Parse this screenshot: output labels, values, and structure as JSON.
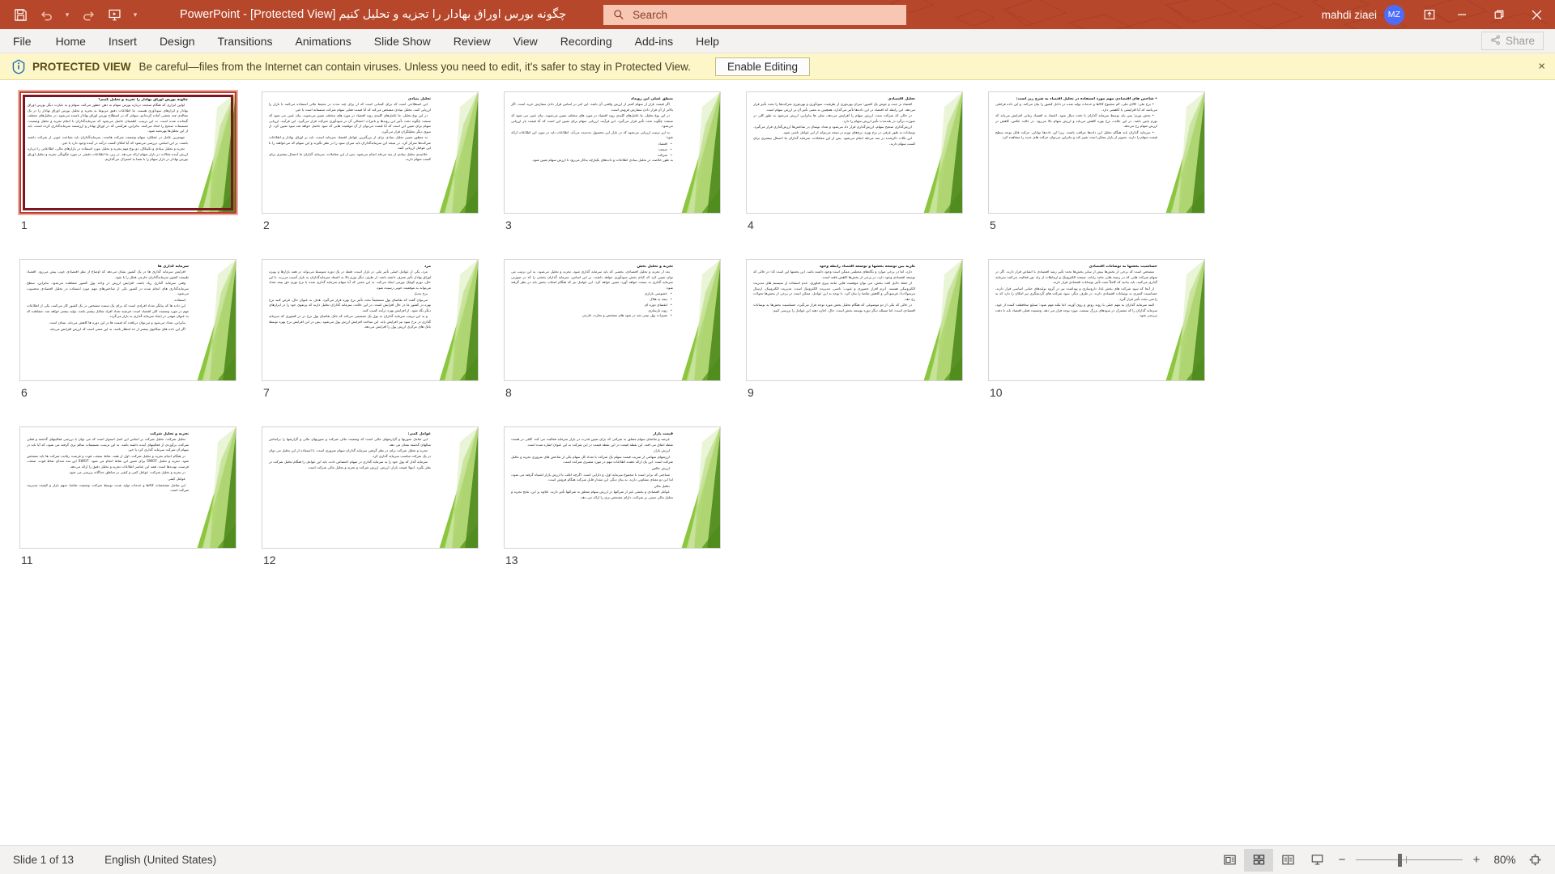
{
  "titlebar": {
    "document_title": "چگونه بورس اوراق بهادار را تجزیه و تحلیل کنیم [Protected View]  -  PowerPoint",
    "quick_access": [
      {
        "name": "save-icon",
        "label": "Save"
      },
      {
        "name": "undo-icon",
        "label": "Undo"
      },
      {
        "name": "undo-dropdown-icon",
        "label": "Undo options"
      },
      {
        "name": "redo-icon",
        "label": "Redo"
      },
      {
        "name": "start-presentation-icon",
        "label": "Start From Beginning"
      },
      {
        "name": "customize-quick-access-toolbar-icon",
        "label": "Customize Quick Access Toolbar"
      }
    ],
    "search": {
      "placeholder": "Search",
      "value": ""
    },
    "account_name": "mahdi ziaei",
    "account_initials": "MZ",
    "ribbon_display_options_label": "Ribbon Display Options",
    "minimize_label": "Minimize",
    "restore_label": "Restore Down",
    "close_label": "Close",
    "bg_color": "#b7472a",
    "search_bg_color": "#f7c7b4",
    "avatar_color": "#4d6cfa"
  },
  "ribbon": {
    "tabs": [
      {
        "label": "File"
      },
      {
        "label": "Home"
      },
      {
        "label": "Insert"
      },
      {
        "label": "Design"
      },
      {
        "label": "Transitions"
      },
      {
        "label": "Animations"
      },
      {
        "label": "Slide Show"
      },
      {
        "label": "Review"
      },
      {
        "label": "View"
      },
      {
        "label": "Recording"
      },
      {
        "label": "Add-ins"
      },
      {
        "label": "Help"
      }
    ],
    "share_label": "Share"
  },
  "protected_view": {
    "title": "PROTECTED VIEW",
    "message": "Be careful—files from the Internet can contain viruses. Unless you need to edit, it's safer to stay in Protected View.",
    "enable_label": "Enable Editing",
    "close_label": "×",
    "bg_color": "#fdf6c8"
  },
  "slides": [
    {
      "number": "1",
      "selected": true,
      "framed": true,
      "title": "چگونه بورس اوراق بهادار را تجزیه و تحلیل کنیم؟",
      "paragraphs": [
        "اولین ابزاری که هنگام صحبت درباره بورس سهام به ذهن خطور می‌کند، سهام و به عبارت دیگر بورس اوراق بهادار و ابزارهای سودآوری هستند. ما اطلاعات دقیق مربوط به تجزیه و تحلیل بورس اوراق بهادار را در یک مقاله‌ی چند بخشی آماده کرده‌ایم، سهام، که در اصطلاح بورس اوراق بهادار نامیده می‌شود، در تحلیل‌های مختلف گنجانده شده است. به این ترتیب، اطمینان حاصل می‌شود که سرمایه‌گذاران با انجام تجزیه و تحلیل وضعیت، تصمیمات صحیح را اتخاذ می‌کنند. بنابراین، هرکسی که در اوراق بهادار و ارزشمند سرمایه‌گذاری کرده است، باید از این تحلیل‌ها بهره‌مند شود.",
        "مهمترین عامل در عملکرد سهام وضعیت شرکت هاست. سرمایه‌گذاران باید شناخت خوبی از شرکت داشته باشند. بر این اساس، بررسی می‌شود که آیا امکان کسب درآمد در آینده وجود دارد یا خیر.",
        "تجزیه و تحلیل بنیادی و تکنیکال، دو نوع مهم تجزیه و تحلیل مورد استفاده در بازارهای مالی، اطلاعاتی را درباره ارزش آینده مقالات در بازار سهام ارائه می‌دهد. در زیر، ما اطلاعات دقیقی در مورد چگونگی تجزیه و تحلیل اوراق بورس بهادار در بازار سهام را با شما به اشتراک می‌گذاریم."
      ],
      "bullets": []
    },
    {
      "number": "2",
      "selected": false,
      "framed": false,
      "title": "تحلیل بنیادی",
      "paragraphs": [
        "این اصطلاحی است که برای کسانی است که از برای چند مدت در محیط مالی استفاده می‌کنند تا بازار را ارزیابی کنند. تحلیل بنیادی مشخص می‌کند که آیا قیمت فعلی سهام شرکت منصفانه است یا خیر.",
        "در این نوع تحلیل، ما عامل‌های کلیدی روند اقتصاد در مورد های مختلف تعیین می‌شوند. بیان عینی می شود که صنعت چگونه تحت تأثیر این روندها و تاثیرات احتمالی آن در سودآوری شرکت قرار می‌گیرد. این فرآیند، ارزیابی سهام برای تعیین این است که آیا قیمت می‌توان از آن موقعیت هایی که سود حاصل خواهد شد سود تعیین کرد. از سوی دیگر تحلیلگران قرار می‌گیرد.",
        "به منظور تعیین تحلیل بنیادی برای از بزرگترین عوامل اقتصاد سرمایه است، باید بر اوراق بهادار و اطلاعات شرکت‌ها تمرکز کرد. در نتیجه این سرمایه‌گذاران باید میزان سود را در نظر بگیرند و این سهام که می‌خواهند را با این عوامل ارزیابی کنند.",
        "خلاصه‌ی تحلیل بنیادی از سه مرحله انجام می‌شود. پس از این معاملات، سرمایه گذاران ما احتمال بیشتری برای کسب سهام دارند."
      ],
      "bullets": []
    },
    {
      "number": "3",
      "selected": false,
      "framed": false,
      "title": "منطق عملی این رویداد",
      "paragraphs": [
        "اگر قیمت بازار از سهام کمتر از ارزش واقعی آن باشد، این امر در اساس قرار دادن سفارش خرید است. اگر بالاتر از آن قرار دادن سفارش فروش است.",
        "در این نوع تحلیل، ما عامل‌های کلیدی روند اقتصاد در مورد های مختلف تعیین می‌شوند. بیان عینی می شود که صنعت چگونه تحت تأثیر قرار می‌گیرد. این فرآیند، ارزیابی سهام برای تعیین این است که آیا قیمت باز ارزیابی می‌شود.",
        "به این ترتیب ارزیابی می‌شود که در بازار این محصول به‌دست می‌آید. اطلاعات باید در مورد این اطلاعات ارائه شود:"
      ],
      "bullets": [
        "اقتصاد",
        "صنعت",
        "شرکت"
      ],
      "tail": "به طور خلاصه، در تحلیل بنیادی اطلاعات و داده‌های یکپارچه به‌کار می‌رود تا ارزش سهام تعیین شود."
    },
    {
      "number": "4",
      "selected": false,
      "framed": false,
      "title": "تحلیل اقتصادی",
      "paragraphs": [
        "اقتصاد بر جنب و جوش یک کشور؛ میزان بهره‌وری از ظرفیت، سودآوری و بهره‌وری شرکت‌ها را تحت تأثیر قرار می‌دهد. این رابطه که اقتصاد در این داده‌ها تأثیر می‌گذارد، همچنین به معنی تأثیر آن بر ارزش سهام است.",
        "در حالی که شرکت منت، ارزش سهام را افزایش می‌دهد، مثلی ها بنابراین، ارزش می‌شود به طور کلی در صورت برگرد در بلندمدت تأثیر ارزش سهام را دارد.",
        "ارزش‌گذاری صحیح سهام، ارزش‌گذاری قرار داد می‌شود و تعداد نوسان در شاخص‌ها ارزش‌گذاری قرار می‌گیرد. نوسانات به طور عرفی در نرخ بهره، نرخ‌های تورم در نتیجه می‌تواند از این عوامل ناشی شود.",
        "این نکات ذکرشده در سه مرحله انجام می‌شود. پس از این معاملات، سرمایه گذاران ما احتمال بیشتری برای کسب سهام دارند."
      ],
      "bullets": []
    },
    {
      "number": "5",
      "selected": false,
      "framed": false,
      "title": "• شاخص های اقتصادی مهم مورد استفاده در تحلیل اقتصاد به شرح زیر است:",
      "paragraphs": [
        "• نرخ ملی: کالای ملی، کم مجموع کالاها و خدمات تولید شده در داخل کشور را بیان می‌کند. و این داده فراملی می‌باشد که آیا افزایشی یا کاهشی دارد.",
        "• بخش تورم: پس باید توسط سرمایه گذاران با دقت دنبال شود. اعتماد به اقتصاد زمانی افزایش می‌یابد که تورم پایین باشد. در این حالت، نرخ بهره کاهش می‌یابد و ارزش سهام بالا می‌رود. در حالت عکس، کاهش در ارزش سهام رخ می‌دهد.",
        "• سرمایه گذاران باید هنگام تحلیل این داده‌ها مراقب باشند. زیرا این داده‌ها توانایی حرکت قابل توجه سطح قیمت سهام را دارند. تصویر از بازار ممکن است تغییر کند و بنابراین می‌توان حرکت های جدید را مشاهده کرد."
      ],
      "bullets": []
    },
    {
      "number": "6",
      "selected": false,
      "framed": false,
      "title": "سرمایه گذاری ها",
      "paragraphs": [
        "افزایش سرمایه گذاری ها در یک کشور نشان می‌دهد که اوضاع از نظر اقتصادی خوب پیش می‌رود. اقتصاد طبیعت کشور سرمایه‌گذاران خارجی فعال را با نفوذ.",
        "وقتی سرمایه گذاری زیاد باشد، افزایش ارزش در واحد پول کشور مشاهده می‌شود. بنابراین، سطح سرمایه‌گذاری های انجام شده در کشور یکی از شاخص‌های مهم مورد استفاده در تحلیل اقتصادی محسوب می‌شود.",
        "استفاده",
        "این داده ها که بیانگر تعداد افرادی است که برای یک سمت مشخص در یک کشور کار می‌کنند، یکی از اطلاعات مهم در مورد وضعیت کلی اقتصاد است. فرضیه تعداد افراد شاغل بیشتر باشد، تولید بیشتر خواهد شد. مشاهده که به عنوان مهمی در ایجاد سرمایه گذاری به بازار می‌گردد.",
        "بنابراین، تعداد می‌شود و می‌توان دریافت که قیمت ها در این دوره ها کاهش می‌یابد. نشان است.",
        "اگر این داده های میکانوی بیشتر از حد انتظار باشد، به این معنی است که ارزش افزایش می‌یابد."
      ],
      "bullets": []
    },
    {
      "number": "7",
      "selected": false,
      "framed": false,
      "title": "مزد",
      "paragraphs": [
        "مزد، یکی از عوامل اصلی تأثیر ملی در بازار است، فقط در یک دوره متوسط می‌تواند در همه بازارها و بویژه اوراق بهادار تأثیر معرف داشته باشد. از طرف دیگر تورم بالا به اعتماد سرمایه‌گذاران به بازار آسیب می‌زند. با این حال، تورم کوچک تورمی ایجاد می‌کند. به این معنی که آیا سهام سرمایه گذاری شده یا نرخ تورم حق بیمه تعداد می‌تواند به موقعیت خوبی رسیده شود.",
        "نرخ تبدیل",
        "می‌توان گفت که تقاضای پول مستقیماً تحت تأثیر نرخ بهره قرار می‌گیرد. هدف به عنوان حال، فرض کنید نرخ بهره در کشور ما در حال افزایش است. در این حالت، سرمایه گذاران تحلیل دارند که پرتفوی خود را در ابزارهای دیگر نگه شود. از افزایش بهره درآمد کسب کنند.",
        "و به این ترتیب سرمایه گذاران به پول یک تصمیمی می‌کند که بانک تقاضای پول نرخ در در کشوری که سرمایه گذاری در نرخ سود نیز افزایش یابد. این ساخت افزایش ارزش پول می‌شود. پس در این افزایش نرخ بهره توسط بانک های مرکزی ارزش پول را افزایش می‌دهد."
      ],
      "bullets": []
    },
    {
      "number": "8",
      "selected": false,
      "framed": false,
      "title": "تجزیه و تحلیل بخش",
      "paragraphs": [
        "بعد از تجزیه و تحلیل اقتصادی، بخشی که باید سرمایه گذاری شود، تجزیه و تحلیل می‌شود. به این ترتیب می توان تعیین کرد که کدام بخش سودآوری خواهد داشت. بر این اساس، سرمایه گذاران بخشی را که در صورتی سرمایه گذاری به سمت خواهد آورد، تعیین خواهد کرد. این عوامل نیز که هنگام انتخاب بخش باید در نظر گرفته شود:"
      ],
      "bullets": [
        "خصوصی بازاری",
        "نیمه به هلاک",
        "اتقضای دوره ای",
        "روند بازسازی",
        "تغییرات پول نیمی شد در شود های مشخص و تجارت خارجی"
      ]
    },
    {
      "number": "9",
      "selected": false,
      "framed": false,
      "title": "نگریه بین توسعه بخشها و توسعه اقتصاد رابطه وجود",
      "paragraphs": [
        "دارد، اما در برخی موارد و نگاه‌های مختلفی ممکن است وجود داشته باشد. این بخشها این است که؛ در حالی که توسعه اقتصادی وجود دارد، در برخی از بخش‌ها کاهش یافته است.",
        "از جمله دلایل افت بخش، می توان موقعیت هایی مانند پیری فناوری، عدم استفاده از سیستم های مدیریت الکترونیکی هستند. (نرم افزار حضوری و عیوب: ناشی، مدیریت الکترونیک است، مدیریت الکترونیک، ارسال مرسولات)، فرسودگی و کاهش تقاضا را بیان کرد. با توجه به این عوامل، ممکن است در برخی از بخش‌ها تحولات رخ دهد.",
        "در حالی که یکی از دو موضوعی که هنگام تحلیل بخش مورد توجه قرار می‌گیرد، حساسیت بخش‌ها به نوسانات اقتصادی است، اما مسئله دیگر دوره توسعه بخش است. حال، اجازه دهید این عوامل را بررسی کنیم."
      ],
      "bullets": []
    },
    {
      "number": "10",
      "selected": false,
      "framed": false,
      "title": "حساسیت بخشها به نوسانات اقتصادی",
      "paragraphs": [
        "مشخص است که برخی از بخش‌ها بیش از سایر بخش‌ها تحت تأثیر رشد اقتصادی یا انقباض قرار دارند. اگر در سهام شرکت هایی که در زمینه هایی مانند رایانه، صنعت الکترونیک و ارتباطات از راه دور فعالیت می‌کنند سرمایه گذاری می‌کنید، باید بدانید که کاملاً تحت تأثیر نوسانات اقتصادی قرار دارند.",
        "از آنجا که سود شرکت های بخش غذا، داروسازی و بهداشت نیز در گروه تولیدهای حیاتی اساسی قرار دارند، حساسیت کمتری به نوسانات اقتصادی دارند. در طرف دیگر، سود شرکت های گردشگری نیز امکان را دارد که به راحتی تحت تأثیر قرار گیرد.",
        "البته سرمایه گذاران به مهم خیلی با روند رونق و روی آورند. اما نکته مهم شود: صنایع محافظت کننده از خود، سرمایه گذاران را که مشترک در سودهای بزرگ نیستند، مورد توجه قرار می دهد. وضعیت فعلی اقتصاد باید با دقت بررسی شود."
      ],
      "bullets": []
    },
    {
      "number": "11",
      "selected": false,
      "framed": false,
      "title": "تجزیه و تحلیل شرکت",
      "paragraphs": [
        "تحلیل شرکت، تحلیل شرکت بر اساس این اصل استوار است که می توان با بررسی فعالیتهای گذشته و فعلی شرکت، برآوردی از فعالیتهای آینده داشته باشد. به این ترتیب، تصمیمات سالم تری گرفته می شود، که آیا باید در سهام آن شرکت سرمایه گذاری کرد یا خیر.",
        "در هنگام انجام تجزیه و تحلیل شرکت، اول از همه، نقاط ضعف، قوت و فرصت رقابت شرکت ها باید مشخص شود. تجزیه و تحلیل SWOT برای تعیین این نقاط انجام می شود. SWOT این سه متدای نقاط قوت، ضعف، فرصت، تهدیدها است. همه این عناصر اطلاعات تجزیه و تحلیل دقیق را ارائه می‌دهد.",
        "در تجزیه و تحلیل شرکت، عوامل کمی و کیفی در مناطق جداگانه بررسی می شود.",
        "عوامل کیفی",
        "این شامل مشخصات کالاها و خدمات تولید شده، توسط شرکت، وضعیت تقاضا، سهم بازار و کیفیت مدیریت شرکت است."
      ],
      "bullets": []
    },
    {
      "number": "12",
      "selected": false,
      "framed": false,
      "title": "عوامل کمی:",
      "paragraphs": [
        "این شامل صورتها و گزارشهای مالی است که وضعیت مالی شرکت و صورتهای مالی و گزارشها را براساس سالهای گذشته نشان می دهد.",
        "تجزیه و تحلیل شرکت برای در نظر گرفتن سرمایه گذاران سهام ضروری است. با استفاده از این تحلیل می توان در یک شرکت مناسب سرمایه گذاری کرد.",
        "سرمایه گذار که پول خود را به سرمایه گذاری در سهام اختصاص داده، باید این عوامل را هنگام تحلیل شرکت در نظر بگیرد. اینها؛ قیمت بازار، ارزش، ارزش شرکت و تجزیه و تحلیل مالی شرکت است."
      ],
      "bullets": []
    },
    {
      "number": "13",
      "selected": false,
      "framed": false,
      "title": "قیمت بازار",
      "paragraphs": [
        "عرضه و تقاضای سهام متعلق به شرکتی که برای تعیین قدرت در بازار سرمایه فعالیت می کند، کافی در هست نقطه اتفاق می افتد. این نقطه قیمت در این نقطه قیمت در این شرکت به این عنوان اشاره شده است.",
        "ارزش بازار",
        "ارزشهای سهامی از ضریب قیمت سهام یک شرکت با تعداد کل سهام یکی از شاخص های ضروری تجزیه و تحلیل شرکت است. این یک ارائه دهنده اطلاعات مهم در مورد معتبری شرکت است.",
        "ارزش خالص",
        "شناختی که برابر است با مجموع سرمایه اول، و دارایی است. اگرچه اغلب با ارزش بازار اشتباه گرفته می شود، اما این دو معنای متفاوتی دارند. به بیان دیگر، این مقدار قابل شرکت هنگام فروش است.",
        "تحلیل مالی",
        "عوامل اقتصادی و بخشی غیر از شرکتها در ارزش سهام متعلق به شرکتها تأثیر دارند. علاوه بر این، نتایج تجزیه و تحلیل مالی مبتنی بر شرکت، دارای مشخص تری را ارائه می دهد."
      ],
      "bullets": []
    }
  ],
  "statusbar": {
    "slide_indicator": "Slide 1 of 13",
    "language": "English (United States)",
    "views": [
      {
        "name": "normal-view-button",
        "label": "Normal",
        "active": false
      },
      {
        "name": "slide-sorter-view-button",
        "label": "Slide Sorter",
        "active": true
      },
      {
        "name": "reading-view-button",
        "label": "Reading View",
        "active": false
      },
      {
        "name": "slide-show-button",
        "label": "Slide Show",
        "active": false
      }
    ],
    "zoom_out_label": "−",
    "zoom_in_label": "+",
    "zoom_level": "80%",
    "fit_label": "Fit slide to current window"
  }
}
